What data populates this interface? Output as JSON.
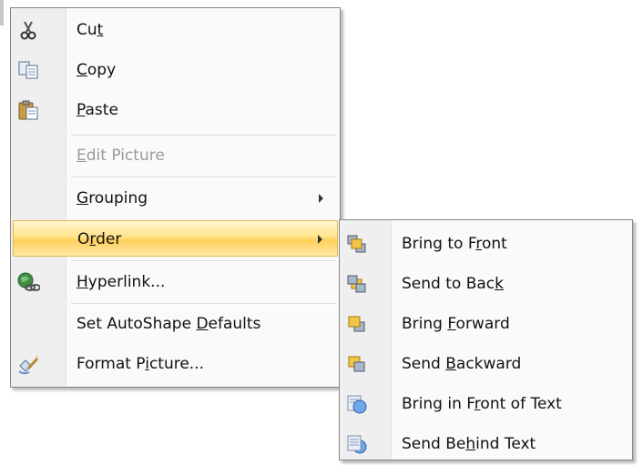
{
  "context_menu": {
    "items": [
      {
        "pre": "Cu",
        "key": "t",
        "post": "",
        "icon": "scissors-icon"
      },
      {
        "pre": "",
        "key": "C",
        "post": "opy",
        "icon": "copy-icon"
      },
      {
        "pre": "",
        "key": "P",
        "post": "aste",
        "icon": "paste-icon"
      },
      {
        "pre": "",
        "key": "E",
        "post": "dit Picture",
        "icon": ""
      },
      {
        "pre": "",
        "key": "G",
        "post": "rouping",
        "icon": ""
      },
      {
        "pre": "O",
        "key": "r",
        "post": "der",
        "icon": ""
      },
      {
        "pre": "",
        "key": "H",
        "post": "yperlink...",
        "icon": "globe-link-icon"
      },
      {
        "pre": "Set AutoShape ",
        "key": "D",
        "post": "efaults",
        "icon": ""
      },
      {
        "pre": "Format P",
        "key": "i",
        "post": "cture...",
        "icon": "format-picture-icon"
      }
    ]
  },
  "order_submenu": {
    "items": [
      {
        "pre": "Bring to F",
        "key": "r",
        "post": "ont",
        "icon": "bring-to-front-icon"
      },
      {
        "pre": "Send to Bac",
        "key": "k",
        "post": "",
        "icon": "send-to-back-icon"
      },
      {
        "pre": "Bring ",
        "key": "F",
        "post": "orward",
        "icon": "bring-forward-icon"
      },
      {
        "pre": "Send ",
        "key": "B",
        "post": "ackward",
        "icon": "send-backward-icon"
      },
      {
        "pre": "Bring in F",
        "key": "r",
        "post": "ont of Text",
        "icon": "bring-in-front-of-text-icon"
      },
      {
        "pre": "Send Be",
        "key": "h",
        "post": "ind Text",
        "icon": "send-behind-text-icon"
      }
    ]
  },
  "colors": {
    "highlight": "#ffd05a",
    "disabled_text": "#9a9a9a",
    "menu_border": "#868686"
  }
}
